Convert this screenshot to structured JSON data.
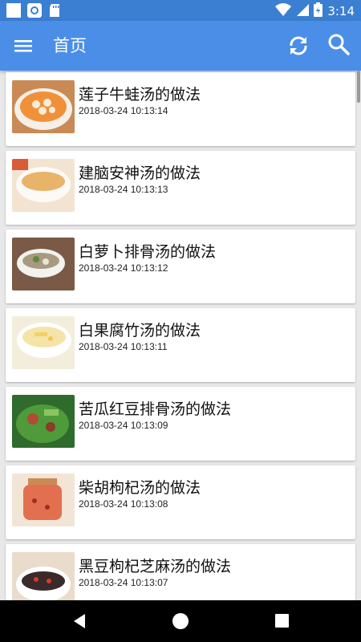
{
  "status_bar": {
    "time": "3:14",
    "icons": [
      "square-app-icon",
      "circle-app-icon",
      "sd-card-icon",
      "wifi-icon",
      "signal-icon",
      "battery-icon"
    ]
  },
  "app_bar": {
    "title": "首页",
    "background": "#4a8ee8",
    "icons": [
      "menu-icon",
      "refresh-icon",
      "search-icon"
    ]
  },
  "list": {
    "items": [
      {
        "title": "莲子牛蛙汤的做法",
        "time": "2018-03-24 10:13:14",
        "image": "soup-bowl-orange"
      },
      {
        "title": "建脑安神汤的做法",
        "time": "2018-03-24 10:13:13",
        "image": "soup-bowl-clear"
      },
      {
        "title": "白萝卜排骨汤的做法",
        "time": "2018-03-24 10:13:12",
        "image": "soup-bowl-pork"
      },
      {
        "title": "白果腐竹汤的做法",
        "time": "2018-03-24 10:13:11",
        "image": "soup-bowl-white"
      },
      {
        "title": "苦瓜红豆排骨汤的做法",
        "time": "2018-03-24 10:13:09",
        "image": "soup-bowl-green"
      },
      {
        "title": "柴胡枸杞汤的做法",
        "time": "2018-03-24 10:13:08",
        "image": "tea-glass-red"
      },
      {
        "title": "黑豆枸杞芝麻汤的做法",
        "time": "2018-03-24 10:13:07",
        "image": "soup-bowl-dark"
      }
    ]
  },
  "nav_bar": {
    "icons": [
      "back-icon",
      "home-icon",
      "recents-icon"
    ]
  }
}
